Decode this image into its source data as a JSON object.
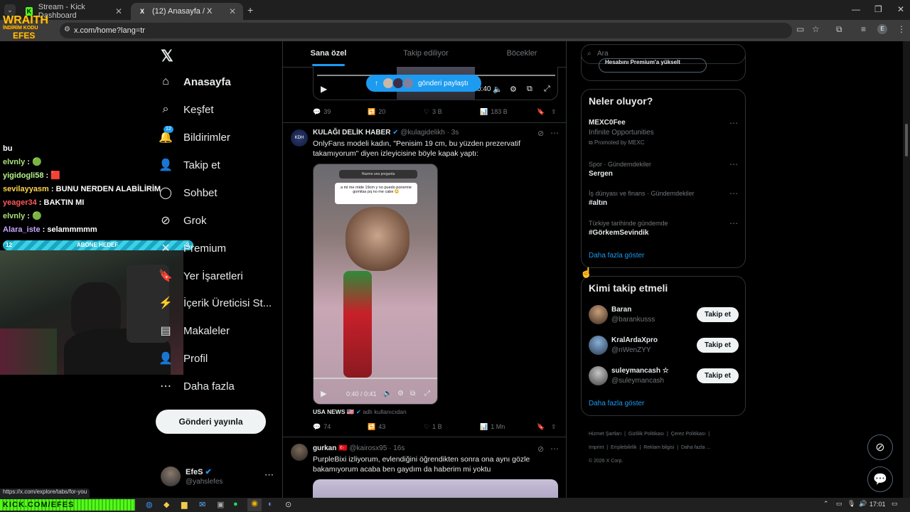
{
  "browser": {
    "tabs": [
      {
        "label": "Stream - Kick Dashboard",
        "favicon": "K"
      },
      {
        "label": "(12) Anasayfa / X",
        "favicon": "X"
      }
    ],
    "url": "x.com/home?lang=tr",
    "profile_letter": "E",
    "status_url": "https://x.com/explore/tabs/for-you"
  },
  "stream": {
    "logo_text": [
      "WRAITH",
      "İNDİRİM KODU",
      "EFES"
    ],
    "chat": [
      {
        "user": "bu",
        "msg": "",
        "color": "#ffffff"
      },
      {
        "user": "elvnly",
        "msg": "🟢",
        "color": "#a8e07a"
      },
      {
        "user": "yigidogli58",
        "msg": "🟥",
        "color": "#b8f58a"
      },
      {
        "user": "sevilayyasm",
        "msg": "BUNU NERDEN ALABİLİRİM",
        "color": "#ffd54a"
      },
      {
        "user": "yeager34",
        "msg": "BAKTIN MI",
        "color": "#ff5959"
      },
      {
        "user": "elvnly",
        "msg": "🟢",
        "color": "#a8e07a"
      },
      {
        "user": "Alara_iste",
        "msg": "selammmmm",
        "color": "#c7a8ff"
      }
    ],
    "sub_goal": {
      "label": "ABONE HEDEF",
      "current": "12",
      "target": "2",
      "progress": 1.0
    },
    "bottom_banner": "KICK.COM/EFES"
  },
  "nav": {
    "items": [
      {
        "label": "Anasayfa",
        "icon": "home-icon",
        "glyph": "⌂",
        "bold": true
      },
      {
        "label": "Keşfet",
        "icon": "search-icon",
        "glyph": "⌕"
      },
      {
        "label": "Bildirimler",
        "icon": "bell-icon",
        "glyph": "🔔",
        "badge": "12"
      },
      {
        "label": "Takip et",
        "icon": "person-plus-icon",
        "glyph": "👤"
      },
      {
        "label": "Sohbet",
        "icon": "chat-icon",
        "glyph": "◯"
      },
      {
        "label": "Grok",
        "icon": "grok-icon",
        "glyph": "⊘"
      },
      {
        "label": "Premium",
        "icon": "x-premium-icon",
        "glyph": "✕"
      },
      {
        "label": "Yer İşaretleri",
        "icon": "bookmark-icon",
        "glyph": "🔖"
      },
      {
        "label": "İçerik Üreticisi St...",
        "icon": "creator-icon",
        "glyph": "⚡"
      },
      {
        "label": "Makaleler",
        "icon": "article-icon",
        "glyph": "▤"
      },
      {
        "label": "Profil",
        "icon": "profile-icon",
        "glyph": "👤"
      },
      {
        "label": "Daha fazla",
        "icon": "more-circle-icon",
        "glyph": "⋯"
      }
    ],
    "post_button": "Gönderi yayınla",
    "account": {
      "name": "EfeS",
      "handle": "@yahslefes"
    }
  },
  "feed": {
    "tabs": [
      "Sana özel",
      "Takip ediliyor",
      "Böcekler"
    ],
    "toast": "gönderi paylaştı",
    "tweet0_actions": {
      "replies": "39",
      "retweets": "20",
      "likes": "3 B",
      "views": "183 B"
    },
    "tweet0_video_time": "0:40",
    "tweet1": {
      "name": "KULAĞI DELİK HABER",
      "handle": "@kulagidelikh",
      "time": "3s",
      "text": "OnlyFans modeli kadın, \"Penisim 19 cm, bu yüzden prezervatif takamıyorum\" diyen izleyicisine böyle kapak yaptı:",
      "video_caption_top": "Hazme una pregunta",
      "video_caption": "a mi me mide 19cm y no puedo ponerme gomitas pq no me cabe 😳",
      "video_time": "0:40 / 0:41",
      "source_name": "USA NEWS 🇺🇸",
      "source_suffix": "adlı kullanıcıdan",
      "actions": {
        "replies": "74",
        "retweets": "43",
        "likes": "1 B",
        "views": "1 Mn"
      }
    },
    "tweet2": {
      "name": "gurkan 🇹🇷",
      "handle": "@kairosx95",
      "time": "16s",
      "text": "PurpleBixi izliyorum, evlendiğini öğrendikten sonra ona aynı gözle bakamıyorum acaba ben gaydım da haberim mi yoktu"
    }
  },
  "sidebar": {
    "search_placeholder": "Ara",
    "premium_chip": "Hesabını Premium'a yükselt",
    "trends_title": "Neler oluyor?",
    "promo": {
      "name": "MEXC0Fee",
      "desc": "Infinite Opportunities",
      "promoted": "Promoted by MEXC"
    },
    "trends": [
      {
        "context": "Spor · Gündemdekiler",
        "topic": "Sergen"
      },
      {
        "context": "İş dünyası ve finans · Gündemdekiler",
        "topic": "#altın"
      },
      {
        "context": "Türkiye tarihinde gündemde",
        "topic": "#GörkemSevindik"
      }
    ],
    "trends_more": "Daha fazla göster",
    "who_title": "Kimi takip etmeli",
    "who": [
      {
        "name": "Baran",
        "handle": "@barankusss"
      },
      {
        "name": "KralArdaXpro",
        "handle": "@nWenZYY"
      },
      {
        "name": "suleymancash ☆",
        "handle": "@suleymancash"
      }
    ],
    "follow_label": "Takip et",
    "who_more": "Daha fazla göster",
    "footer": [
      "Hizmet Şartları",
      "Gizlilik Politikası",
      "Çerez Politikası",
      "Imprint",
      "Erişilebilirlik",
      "Reklam bilgisi",
      "Daha fazla ...",
      "© 2026 X Corp."
    ]
  },
  "taskbar": {
    "time": "17:01"
  },
  "colors": {
    "accent": "#1d9bf0",
    "bg": "#000000",
    "border": "#2f3336",
    "muted": "#71767b"
  }
}
